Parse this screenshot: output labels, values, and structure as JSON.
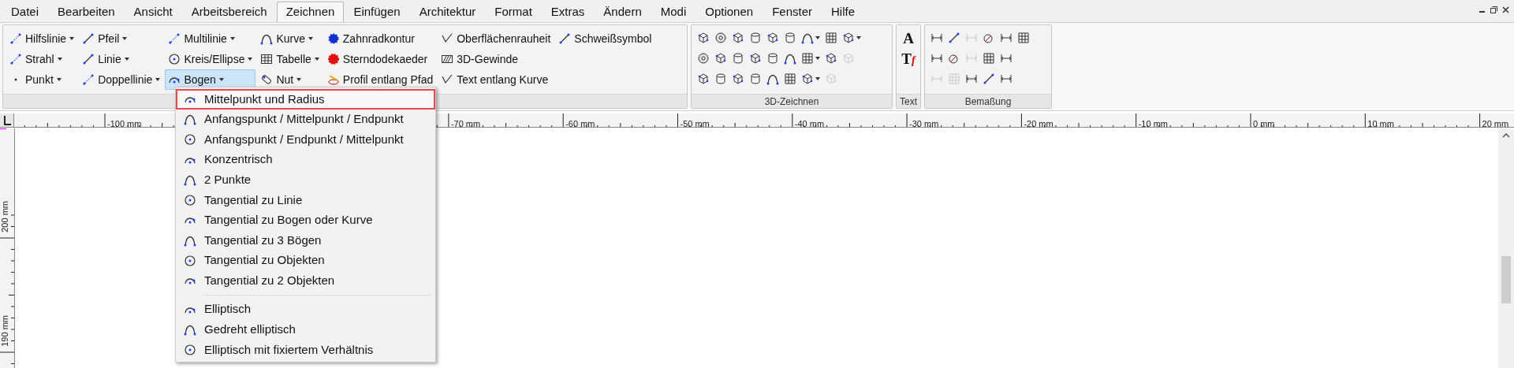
{
  "menu_bar": [
    {
      "label": "Datei",
      "selected": false
    },
    {
      "label": "Bearbeiten",
      "selected": false
    },
    {
      "label": "Ansicht",
      "selected": false
    },
    {
      "label": "Arbeitsbereich",
      "selected": false
    },
    {
      "label": "Zeichnen",
      "selected": true
    },
    {
      "label": "Einfügen",
      "selected": false
    },
    {
      "label": "Architektur",
      "selected": false
    },
    {
      "label": "Format",
      "selected": false
    },
    {
      "label": "Extras",
      "selected": false
    },
    {
      "label": "Ändern",
      "selected": false
    },
    {
      "label": "Modi",
      "selected": false
    },
    {
      "label": "Optionen",
      "selected": false
    },
    {
      "label": "Fenster",
      "selected": false
    },
    {
      "label": "Hilfe",
      "selected": false
    }
  ],
  "draw_group": {
    "columns": [
      [
        {
          "label": "Hilfslinie",
          "dropdown": true,
          "selected": false
        },
        {
          "label": "Strahl",
          "dropdown": true,
          "selected": false
        },
        {
          "label": "Punkt",
          "dropdown": true,
          "selected": false
        }
      ],
      [
        {
          "label": "Pfeil",
          "dropdown": true,
          "selected": false
        },
        {
          "label": "Linie",
          "dropdown": true,
          "selected": false
        },
        {
          "label": "Doppellinie",
          "dropdown": true,
          "selected": false
        }
      ],
      [
        {
          "label": "Multilinie",
          "dropdown": true,
          "selected": false
        },
        {
          "label": "Kreis/Ellipse",
          "dropdown": true,
          "selected": false
        },
        {
          "label": "Bogen",
          "dropdown": true,
          "selected": true
        }
      ],
      [
        {
          "label": "Kurve",
          "dropdown": true,
          "selected": false
        },
        {
          "label": "Tabelle",
          "dropdown": true,
          "selected": false
        },
        {
          "label": "Nut",
          "dropdown": true,
          "selected": false
        }
      ],
      [
        {
          "label": "Zahnradkontur",
          "dropdown": false,
          "selected": false
        },
        {
          "label": "Sterndodekaeder",
          "dropdown": false,
          "selected": false
        },
        {
          "label": "Profil entlang Pfad",
          "dropdown": false,
          "selected": false
        }
      ],
      [
        {
          "label": "Oberflächenrauheit",
          "dropdown": false,
          "selected": false
        },
        {
          "label": "3D-Gewinde",
          "dropdown": false,
          "selected": false
        },
        {
          "label": "Text entlang Kurve",
          "dropdown": false,
          "selected": false
        }
      ],
      [
        {
          "label": "Schweißsymbol",
          "dropdown": false,
          "selected": false
        }
      ]
    ]
  },
  "groups": [
    {
      "label": "3D-Zeichnen",
      "rows": [
        [
          {
            "dropdown": false,
            "disabled": false
          },
          {
            "dropdown": false,
            "disabled": false
          },
          {
            "dropdown": false,
            "disabled": false
          },
          {
            "dropdown": false,
            "disabled": false
          },
          {
            "dropdown": false,
            "disabled": false
          },
          {
            "dropdown": false,
            "disabled": false
          },
          {
            "dropdown": true,
            "disabled": false
          },
          {
            "dropdown": false,
            "disabled": false
          },
          {
            "dropdown": true,
            "disabled": false
          }
        ],
        [
          {
            "dropdown": false,
            "disabled": false
          },
          {
            "dropdown": false,
            "disabled": false
          },
          {
            "dropdown": false,
            "disabled": false
          },
          {
            "dropdown": false,
            "disabled": false
          },
          {
            "dropdown": false,
            "disabled": false
          },
          {
            "dropdown": false,
            "disabled": false
          },
          {
            "dropdown": true,
            "disabled": false
          },
          {
            "dropdown": false,
            "disabled": false
          },
          {
            "dropdown": false,
            "disabled": true
          }
        ],
        [
          {
            "dropdown": false,
            "disabled": false
          },
          {
            "dropdown": false,
            "disabled": false
          },
          {
            "dropdown": false,
            "disabled": false
          },
          {
            "dropdown": false,
            "disabled": false
          },
          {
            "dropdown": false,
            "disabled": false
          },
          {
            "dropdown": false,
            "disabled": false
          },
          {
            "dropdown": true,
            "disabled": false
          },
          {
            "dropdown": false,
            "disabled": true
          }
        ]
      ]
    },
    {
      "label": "Text",
      "glyphs": [
        {
          "main": "A"
        },
        {
          "main": "T",
          "accent": "f"
        }
      ]
    },
    {
      "label": "Bemaßung",
      "rows": [
        [
          {
            "dropdown": false,
            "disabled": false
          },
          {
            "dropdown": false,
            "disabled": false
          },
          {
            "dropdown": false,
            "disabled": true
          },
          {
            "dropdown": false,
            "disabled": false
          },
          {
            "dropdown": false,
            "disabled": false
          },
          {
            "dropdown": false,
            "disabled": false
          }
        ],
        [
          {
            "dropdown": false,
            "disabled": false
          },
          {
            "dropdown": false,
            "disabled": false
          },
          {
            "dropdown": false,
            "disabled": true
          },
          {
            "dropdown": false,
            "disabled": false
          },
          {
            "dropdown": false,
            "disabled": false
          }
        ],
        [
          {
            "dropdown": false,
            "disabled": true
          },
          {
            "dropdown": false,
            "disabled": true
          },
          {
            "dropdown": false,
            "disabled": false
          },
          {
            "dropdown": false,
            "disabled": false
          },
          {
            "dropdown": false,
            "disabled": false
          }
        ]
      ]
    }
  ],
  "ruler": {
    "horizontal_left": [
      "-100 mm"
    ],
    "horizontal_right": [
      "-70 mm",
      "-60 mm",
      "-50 mm",
      "-40 mm",
      "-30 mm",
      "-20 mm",
      "-10 mm",
      "0 mm",
      "10 mm",
      "20 mm"
    ],
    "vertical": [
      "200 mm",
      "190 mm"
    ]
  },
  "dropdown_menu": {
    "sections": [
      [
        {
          "label": "Mittelpunkt und Radius",
          "selected": true
        },
        {
          "label": "Anfangspunkt / Mittelpunkt / Endpunkt",
          "selected": false
        },
        {
          "label": "Anfangspunkt / Endpunkt / Mittelpunkt",
          "selected": false
        },
        {
          "label": "Konzentrisch",
          "selected": false
        },
        {
          "label": "2 Punkte",
          "selected": false
        },
        {
          "label": "Tangential zu Linie",
          "selected": false
        },
        {
          "label": "Tangential zu Bogen oder Kurve",
          "selected": false
        },
        {
          "label": "Tangential zu 3 Bögen",
          "selected": false
        },
        {
          "label": "Tangential zu Objekten",
          "selected": false
        },
        {
          "label": "Tangential zu 2 Objekten",
          "selected": false
        }
      ],
      [
        {
          "label": "Elliptisch",
          "selected": false
        },
        {
          "label": "Gedreht elliptisch",
          "selected": false
        },
        {
          "label": "Elliptisch mit fixiertem Verhältnis",
          "selected": false
        }
      ]
    ]
  }
}
